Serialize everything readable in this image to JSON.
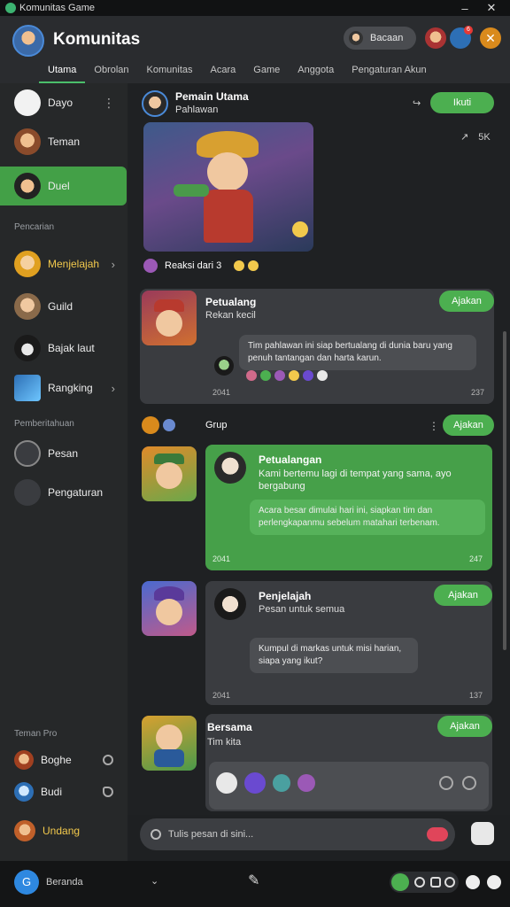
{
  "window": {
    "title": "Komunitas Game",
    "minimize": "–",
    "close": "✕"
  },
  "header": {
    "app_name": "Komunitas",
    "pill_label": "Bacaan",
    "notif_count": "6",
    "tabs": [
      {
        "label": "Utama",
        "active": true
      },
      {
        "label": "Obrolan",
        "active": false
      },
      {
        "label": "Komunitas",
        "active": false
      },
      {
        "label": "Acara",
        "active": false
      },
      {
        "label": "Game",
        "active": false
      },
      {
        "label": "Anggota",
        "active": false
      },
      {
        "label": "Pengaturan Akun",
        "active": false
      }
    ]
  },
  "sidebar": {
    "top_items": [
      {
        "label": "Dayo",
        "icon": "chat-bubble-icon"
      },
      {
        "label": "Teman",
        "icon": "friends-icon"
      },
      {
        "label": "Duel",
        "icon": "duel-icon",
        "active": true
      }
    ],
    "section_1": "Pencarian",
    "mid_items": [
      {
        "label": "Menjelajah",
        "icon": "explore-icon",
        "chevron": "›"
      },
      {
        "label": "Guild",
        "icon": "guild-icon"
      },
      {
        "label": "Bajak laut",
        "icon": "pirate-icon"
      },
      {
        "label": "Rangking",
        "icon": "rank-icon",
        "chevron": "›"
      }
    ],
    "section_2": "Pemberitahuan",
    "lower_items": [
      {
        "label": "Pesan",
        "icon": "message-icon"
      },
      {
        "label": "Pengaturan",
        "icon": "settings-icon"
      }
    ],
    "section_3": "Teman Pro",
    "bottom_items": [
      {
        "label": "Boghe",
        "icon": "user-icon"
      },
      {
        "label": "Budi",
        "icon": "user-icon"
      },
      {
        "label": "Undang",
        "icon": "invite-icon"
      }
    ]
  },
  "feed": {
    "post_1": {
      "name": "Pemain Utama",
      "sub": "Pahlawan",
      "action": "Ikuti",
      "likes_label": "5K",
      "reaction_label": "Reaksi dari 3"
    },
    "card_1": {
      "title": "Petualang",
      "sub": "Rekan kecil",
      "pill": "Ajakan",
      "text": "Tim pahlawan ini siap bertualang di dunia baru yang penuh tantangan dan harta karun.",
      "ts_left": "2041",
      "ts_right": "237"
    },
    "group_header": {
      "label": "Grup",
      "pill": "Ajakan"
    },
    "card_2": {
      "title": "Petualangan",
      "sub": "Kami bertemu lagi di tempat yang sama, ayo bergabung",
      "text": "Acara besar dimulai hari ini, siapkan tim dan perlengkapanmu sebelum matahari terbenam.",
      "ts_left": "2041",
      "ts_right": "247"
    },
    "card_3": {
      "title": "Penjelajah",
      "sub": "Pesan untuk semua",
      "pill": "Ajakan",
      "text": "Kumpul di markas untuk misi harian, siapa yang ikut?",
      "ts_left": "2041",
      "ts_right": "137"
    },
    "card_4": {
      "title": "Bersama",
      "sub": "Tim kita",
      "pill": "Ajakan"
    }
  },
  "composer": {
    "placeholder": "Tulis pesan di sini..."
  },
  "bottombar": {
    "app_label": "Beranda",
    "app_icon_letter": "G"
  },
  "colors": {
    "accent": "#4caf50",
    "background": "#1f2123",
    "card": "#3a3c40"
  }
}
